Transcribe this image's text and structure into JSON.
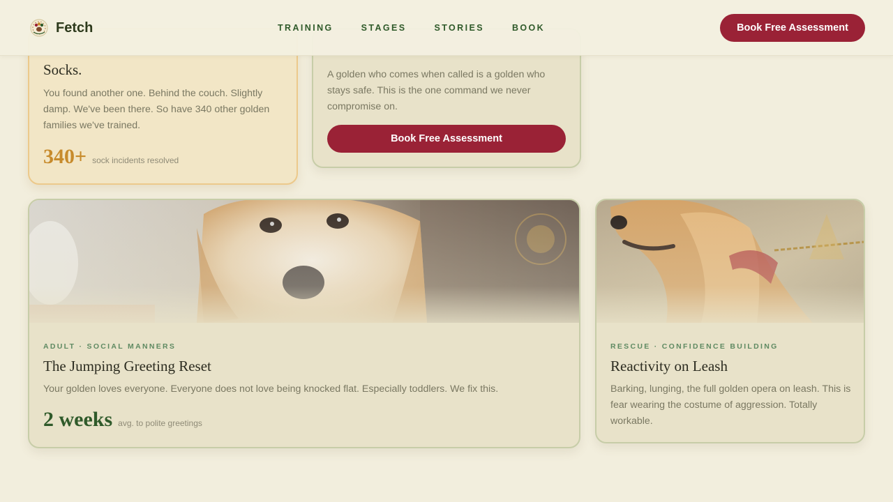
{
  "header": {
    "brand": "Fetch",
    "nav": [
      "TRAINING",
      "STAGES",
      "STORIES",
      "BOOK"
    ],
    "cta": "Book Free Assessment"
  },
  "cards": {
    "socks": {
      "title": "Socks.",
      "description": "You found another one. Behind the couch. Slightly damp. We've been there. So have 340 other golden families we've trained.",
      "stat_value": "340+",
      "stat_label": "sock incidents resolved"
    },
    "recall": {
      "description": "A golden who comes when called is a golden who stays safe. This is the one command we never compromise on.",
      "button": "Book Free Assessment"
    },
    "jumping": {
      "eyebrow": "ADULT · SOCIAL MANNERS",
      "title": "The Jumping Greeting Reset",
      "description": "Your golden loves everyone. Everyone does not love being knocked flat. Especially toddlers. We fix this.",
      "stat_value": "2 weeks",
      "stat_label": "avg. to polite greetings",
      "image": "golden-retriever-portrait-photo"
    },
    "leash": {
      "eyebrow": "RESCUE · CONFIDENCE BUILDING",
      "title": "Reactivity on Leash",
      "description": "Barking, lunging, the full golden opera on leash. This is fear wearing the costume of aggression. Totally workable.",
      "image": "golden-retriever-on-leash-photo"
    }
  },
  "colors": {
    "background": "#f2eedd",
    "primary_cta": "#9a2236",
    "nav_green": "#2f5a2a",
    "stat_gold": "#c78b2c",
    "eyebrow_green": "#5f8a62"
  }
}
